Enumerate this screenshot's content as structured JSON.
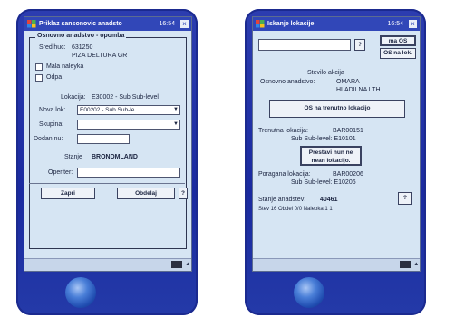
{
  "left": {
    "title": "Priklaz sansonovic anadsto",
    "clock": "16:54",
    "close": "×",
    "group_title": "Osnovno anadstvo - opomba",
    "sifra_label": "Sredihuc:",
    "sifra_value": "631250",
    "product_name": "PIZA DELTURA GR",
    "check1_label": "Mala naleyka",
    "check2_label": "Odpa",
    "lokacija_label": "Lokacija:",
    "lokacija_value": "E30002 - Sub Sub-level",
    "nova_lok_label": "Nova lok:",
    "nova_lok_value": "E00202 - Sub Sub-le",
    "skupina_label": "Skupina:",
    "skupina_value": "",
    "dodan_label": "Dodan nu:",
    "dodan_value": "",
    "stanje_label": "Stanje",
    "stanje_value": "BRONDMLAND",
    "operater_label": "Operiter:",
    "operater_value": "",
    "zapri_label": "Zapri",
    "obdelaj_label": "Obdelaj",
    "side_btn_label": "?"
  },
  "right": {
    "title": "Iskanje lokacije",
    "clock": "16:54",
    "close": "×",
    "search_value": "",
    "help_btn": "?",
    "na_os_btn": "ma OS",
    "os_na_lok_btn": "OS na lok.",
    "stevilo_label": "Stevilo akcija",
    "osnovno_label": "Osnovno anadstvo:",
    "osnovno_value1": "OMARA",
    "osnovno_value2": "HLADILNA LTH",
    "os_trenutno_btn": "OS na trenutno lokacijo",
    "trenutna_label": "Trenutna lokacija:",
    "trenutna_value": "BAR00151",
    "trenutna_sub": "Sub Sub-level: E10101",
    "prestavi_line1": "Prestavi nun ne",
    "prestavi_line2": "nean lokacijo.",
    "poragana_label": "Poragana lokacija:",
    "poragana_value": "BAR00206",
    "poragana_sub": "Sub Sub-level: E10206",
    "stanje_label": "Stanje anadstev:",
    "stanje_value": "40461",
    "bottom_help": "?",
    "footer_text": "Stev 16     Obdel 0/0     Nalepka 1 1"
  }
}
